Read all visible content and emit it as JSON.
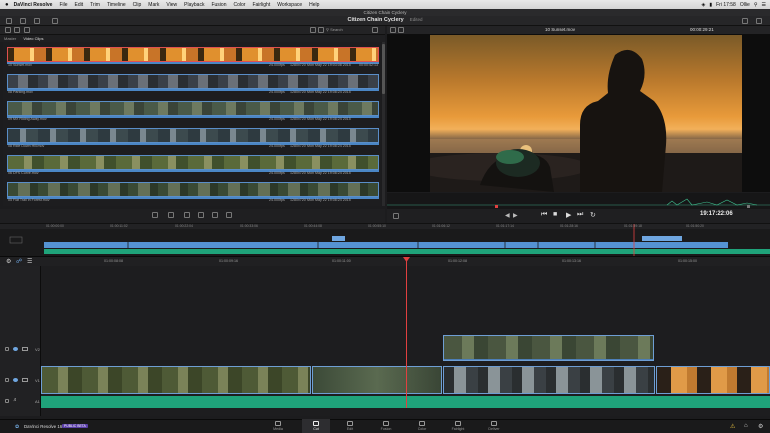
{
  "menubar": {
    "app": "DaVinci Resolve",
    "items": [
      "File",
      "Edit",
      "Trim",
      "Timeline",
      "Clip",
      "Mark",
      "View",
      "Playback",
      "Fusion",
      "Color",
      "Fairlight",
      "Workspace",
      "Help"
    ],
    "clock": "Fri 17:58",
    "user": "Ollie"
  },
  "window": {
    "title": "Citizen Chain Cyclery"
  },
  "project": {
    "name": "Citizen Chain Cyclery",
    "status": "Edited"
  },
  "media_pool": {
    "search_label": "Search",
    "bins": [
      "Master",
      "Video Clips"
    ],
    "clips": [
      {
        "name": "10 Sunset.mov",
        "fps": "24.000fps",
        "res": "1280x720",
        "date": "Mon May 22 19:03:08 2015",
        "dur": "00:00:42:13"
      },
      {
        "name": "08 Parking.mov",
        "fps": "24.000fps",
        "res": "1280x720",
        "date": "Mon May 22 19:08:24 2015",
        "dur": ""
      },
      {
        "name": "09 MX Riding Away.mov",
        "fps": "24.000fps",
        "res": "1280x720",
        "date": "Mon May 22 19:08:24 2015",
        "dur": ""
      },
      {
        "name": "08 Ride Down Hill.mov",
        "fps": "24.000fps",
        "res": "1280x720",
        "date": "Mon May 22 19:08:24 2015",
        "dur": ""
      },
      {
        "name": "06 DFS Curve.mov",
        "fps": "24.000fps",
        "res": "1280x720",
        "date": "Mon May 22 19:08:24 2015",
        "dur": ""
      },
      {
        "name": "05 Flat Trail in Forest.mov",
        "fps": "24.000fps",
        "res": "1280x720",
        "date": "Mon May 22 19:08:24 2015",
        "dur": ""
      }
    ]
  },
  "viewer": {
    "clip_name": "10 Sunset.mov",
    "timecode": "00:00:29:21",
    "timeline_timecode": "19:17:22:06"
  },
  "timeline": {
    "ruler_mini": [
      "01:00:00:00",
      "01:00:11:02",
      "01:00:22:04",
      "01:00:33:06",
      "01:00:44:08",
      "01:00:55:10",
      "01:01:06:12",
      "01:01:17:14",
      "01:01:28:16",
      "01:01:39:18",
      "01:01:50:20"
    ],
    "ruler_main": [
      "01:00:08:08",
      "01:00:09:16",
      "01:00:11:00",
      "01:00:12:08",
      "01:00:13:16",
      "01:00:15:00"
    ],
    "tracks": [
      "V2",
      "V1",
      "A1"
    ]
  },
  "footer": {
    "product": "DaVinci Resolve 16",
    "badge": "PUBLIC BETA",
    "pages": [
      "Media",
      "Cut",
      "Edit",
      "Fusion",
      "Color",
      "Fairlight",
      "Deliver"
    ],
    "active_page": "Cut"
  },
  "colors": {
    "accent": "#5a8ec8",
    "playhead": "#e04040",
    "audio": "#1fa37a"
  }
}
